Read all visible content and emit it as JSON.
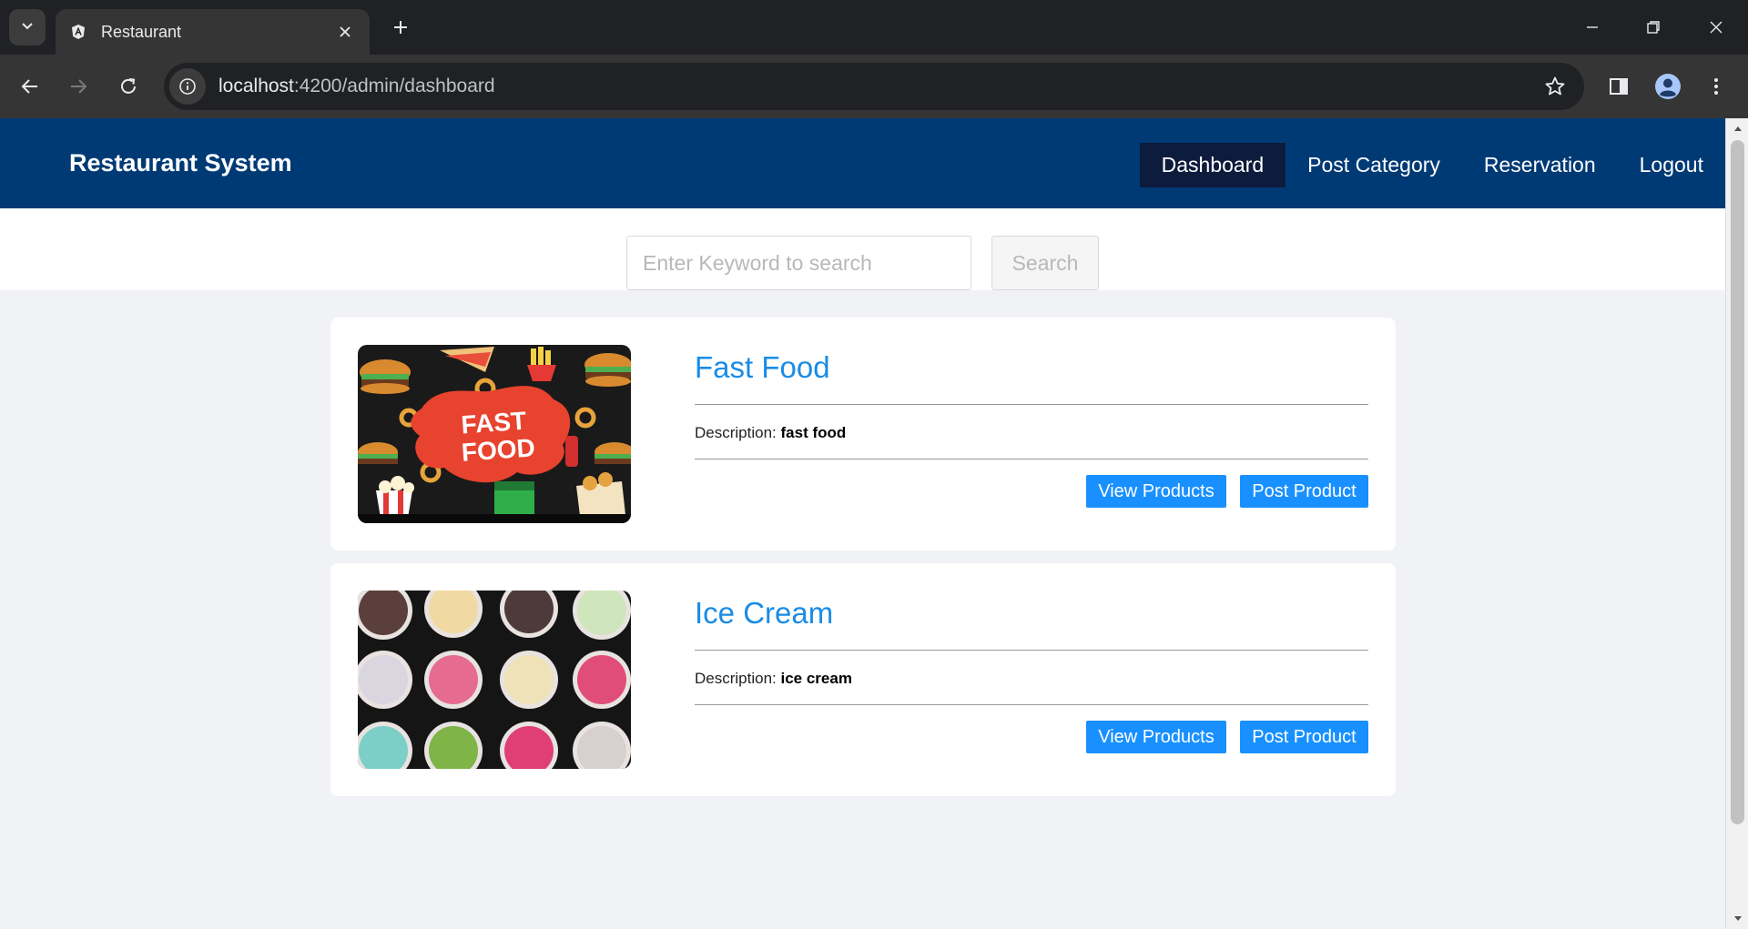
{
  "browser": {
    "tab_title": "Restaurant",
    "url_host": "localhost",
    "url_path": ":4200/admin/dashboard",
    "icons": [
      "tab-list-icon",
      "angular-favicon-icon",
      "close-icon",
      "plus-icon",
      "minimize-icon",
      "restore-icon",
      "window-close-icon",
      "back-icon",
      "forward-icon",
      "reload-icon",
      "site-info-icon",
      "star-icon",
      "side-panel-icon",
      "profile-icon",
      "kebab-menu-icon"
    ]
  },
  "header": {
    "brand": "Restaurant System",
    "menu": [
      {
        "label": "Dashboard",
        "active": true
      },
      {
        "label": "Post Category",
        "active": false
      },
      {
        "label": "Reservation",
        "active": false
      },
      {
        "label": "Logout",
        "active": false
      }
    ]
  },
  "search": {
    "placeholder": "Enter Keyword to search",
    "button_label": "Search"
  },
  "categories": [
    {
      "title": "Fast Food",
      "description_label": "Description:",
      "description": "fast food",
      "image_text": "FAST FOOD",
      "view_label": "View Products",
      "post_label": "Post Product"
    },
    {
      "title": "Ice Cream",
      "description_label": "Description:",
      "description": "ice cream",
      "view_label": "View Products",
      "post_label": "Post Product"
    }
  ],
  "colors": {
    "header_bg": "#003a75",
    "active_menu_bg": "#0d1b3c",
    "title_blue": "#1a8ce6",
    "button_blue": "#1890ff",
    "page_bg": "#f0f2f5"
  }
}
